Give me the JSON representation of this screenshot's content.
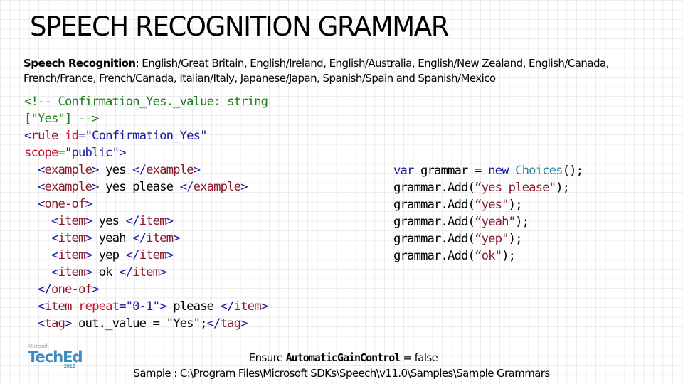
{
  "slide": {
    "title": "SPEECH RECOGNITION GRAMMAR",
    "subtitle_label": "Speech Recognition",
    "subtitle_sep": ": ",
    "subtitle_text": "English/Great Britain, English/Ireland, English/Australia, English/New Zealand, English/Canada, French/France, French/Canada, Italian/Italy, Japanese/Japan, Spanish/Spain and Spanish/Mexico"
  },
  "xml_code": {
    "lines": [
      [
        {
          "t": "<!-- Confirmation_Yes._value: string",
          "c": "comment"
        }
      ],
      [
        {
          "t": "[\"Yes\"] -->",
          "c": "comment"
        }
      ],
      [
        {
          "t": "<",
          "c": "tag"
        },
        {
          "t": "rule",
          "c": "name"
        },
        {
          "t": " ",
          "c": "text"
        },
        {
          "t": "id",
          "c": "attr"
        },
        {
          "t": "=\"Confirmation_Yes\"",
          "c": "val"
        }
      ],
      [
        {
          "t": "scope",
          "c": "attr"
        },
        {
          "t": "=\"public\">",
          "c": "val"
        }
      ],
      [
        {
          "t": "  <",
          "c": "tag"
        },
        {
          "t": "example",
          "c": "name"
        },
        {
          "t": ">",
          "c": "tag"
        },
        {
          "t": " yes ",
          "c": "text"
        },
        {
          "t": "</",
          "c": "tag"
        },
        {
          "t": "example",
          "c": "name"
        },
        {
          "t": ">",
          "c": "tag"
        }
      ],
      [
        {
          "t": "  <",
          "c": "tag"
        },
        {
          "t": "example",
          "c": "name"
        },
        {
          "t": ">",
          "c": "tag"
        },
        {
          "t": " yes please ",
          "c": "text"
        },
        {
          "t": "</",
          "c": "tag"
        },
        {
          "t": "example",
          "c": "name"
        },
        {
          "t": ">",
          "c": "tag"
        }
      ],
      [
        {
          "t": "  <",
          "c": "tag"
        },
        {
          "t": "one-of",
          "c": "name"
        },
        {
          "t": ">",
          "c": "tag"
        }
      ],
      [
        {
          "t": "    <",
          "c": "tag"
        },
        {
          "t": "item",
          "c": "name"
        },
        {
          "t": ">",
          "c": "tag"
        },
        {
          "t": " yes ",
          "c": "text"
        },
        {
          "t": "</",
          "c": "tag"
        },
        {
          "t": "item",
          "c": "name"
        },
        {
          "t": ">",
          "c": "tag"
        }
      ],
      [
        {
          "t": "    <",
          "c": "tag"
        },
        {
          "t": "item",
          "c": "name"
        },
        {
          "t": ">",
          "c": "tag"
        },
        {
          "t": " yeah ",
          "c": "text"
        },
        {
          "t": "</",
          "c": "tag"
        },
        {
          "t": "item",
          "c": "name"
        },
        {
          "t": ">",
          "c": "tag"
        }
      ],
      [
        {
          "t": "    <",
          "c": "tag"
        },
        {
          "t": "item",
          "c": "name"
        },
        {
          "t": ">",
          "c": "tag"
        },
        {
          "t": " yep ",
          "c": "text"
        },
        {
          "t": "</",
          "c": "tag"
        },
        {
          "t": "item",
          "c": "name"
        },
        {
          "t": ">",
          "c": "tag"
        }
      ],
      [
        {
          "t": "    <",
          "c": "tag"
        },
        {
          "t": "item",
          "c": "name"
        },
        {
          "t": ">",
          "c": "tag"
        },
        {
          "t": " ok ",
          "c": "text"
        },
        {
          "t": "</",
          "c": "tag"
        },
        {
          "t": "item",
          "c": "name"
        },
        {
          "t": ">",
          "c": "tag"
        }
      ],
      [
        {
          "t": "  </",
          "c": "tag"
        },
        {
          "t": "one-of",
          "c": "name"
        },
        {
          "t": ">",
          "c": "tag"
        }
      ],
      [
        {
          "t": "  <",
          "c": "tag"
        },
        {
          "t": "item",
          "c": "name"
        },
        {
          "t": " ",
          "c": "text"
        },
        {
          "t": "repeat",
          "c": "attr"
        },
        {
          "t": "=\"0-1\">",
          "c": "val"
        },
        {
          "t": " please ",
          "c": "text"
        },
        {
          "t": "</",
          "c": "tag"
        },
        {
          "t": "item",
          "c": "name"
        },
        {
          "t": ">",
          "c": "tag"
        }
      ],
      [
        {
          "t": "  <",
          "c": "tag"
        },
        {
          "t": "tag",
          "c": "name"
        },
        {
          "t": ">",
          "c": "tag"
        },
        {
          "t": " out._value = \"Yes\";",
          "c": "text"
        },
        {
          "t": "</",
          "c": "tag"
        },
        {
          "t": "tag",
          "c": "name"
        },
        {
          "t": ">",
          "c": "tag"
        }
      ]
    ]
  },
  "cs_code": {
    "lines": [
      [
        {
          "t": "var",
          "c": "kw"
        },
        {
          "t": " grammar = ",
          "c": "text"
        },
        {
          "t": "new",
          "c": "kw"
        },
        {
          "t": " ",
          "c": "text"
        },
        {
          "t": "Choices",
          "c": "type"
        },
        {
          "t": "();",
          "c": "text"
        }
      ],
      [
        {
          "t": "grammar.Add(",
          "c": "text"
        },
        {
          "t": "“yes please\"",
          "c": "str"
        },
        {
          "t": ");",
          "c": "text"
        }
      ],
      [
        {
          "t": "grammar.Add(",
          "c": "text"
        },
        {
          "t": "“yes\"",
          "c": "str"
        },
        {
          "t": ");",
          "c": "text"
        }
      ],
      [
        {
          "t": "grammar.Add(",
          "c": "text"
        },
        {
          "t": "“yeah\"",
          "c": "str"
        },
        {
          "t": ");",
          "c": "text"
        }
      ],
      [
        {
          "t": "grammar.Add(",
          "c": "text"
        },
        {
          "t": "“yep\"",
          "c": "str"
        },
        {
          "t": ");",
          "c": "text"
        }
      ],
      [
        {
          "t": "grammar.Add(",
          "c": "text"
        },
        {
          "t": "“ok\"",
          "c": "str"
        },
        {
          "t": ");",
          "c": "text"
        }
      ]
    ]
  },
  "logo": {
    "maker": "Microsoft",
    "name": "TechEd",
    "year": "2012"
  },
  "footer": {
    "line1_prefix": "Ensure ",
    "line1_code": "AutomaticGainControl",
    "line1_suffix": " = false",
    "line2": "Sample : C:\\Program Files\\Microsoft SDKs\\Speech\\v11.0\\Samples\\Sample Grammars"
  },
  "colors": {
    "comment": "#1f7a1f",
    "tag": "#1a1aa6",
    "element_name": "#8b1a2b",
    "attribute": "#c8102e",
    "keyword": "#1a1aa6",
    "type": "#2b8a9a",
    "string": "#8b1a2b",
    "logo": "#3c8ac4"
  }
}
